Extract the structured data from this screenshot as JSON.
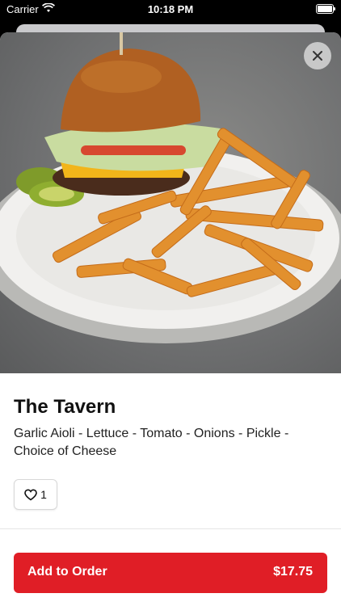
{
  "status_bar": {
    "carrier": "Carrier",
    "time": "10:18 PM"
  },
  "item": {
    "name": "The Tavern",
    "description": "Garlic Aioli - Lettuce - Tomato - Onions - Pickle - Choice of Cheese",
    "likes": "1",
    "photo_icon": "burger-and-fries-photo"
  },
  "actions": {
    "add_to_order_label": "Add to Order",
    "price": "$17.75",
    "close_icon": "close-icon",
    "like_icon": "heart-icon"
  },
  "colors": {
    "accent": "#e01e26",
    "background": "#ffffff",
    "status_bar": "#000000"
  }
}
